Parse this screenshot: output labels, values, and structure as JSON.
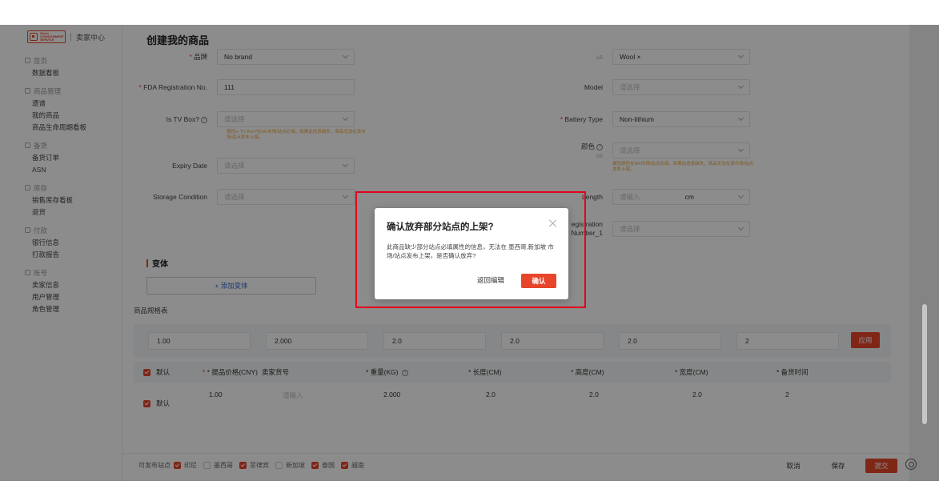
{
  "sidebar": {
    "logo_text": [
      "Shein",
      "CONSIGNMENT",
      "SERVICE"
    ],
    "brand_title": "卖家中心",
    "sections": [
      {
        "head": "首页",
        "items": [
          "数据看板"
        ]
      },
      {
        "head": "商品管理",
        "items": [
          "遗谱",
          "我的商品",
          "商品生命周期看板"
        ]
      },
      {
        "head": "备货",
        "items": [
          "备货订单",
          "ASN"
        ]
      },
      {
        "head": "库存",
        "items": [
          "销售库存看板",
          "退货"
        ]
      },
      {
        "head": "付款",
        "items": [
          "银行信息",
          "打款报告"
        ]
      },
      {
        "head": "账号",
        "items": [
          "卖家信息",
          "用户管理",
          "角色管理"
        ]
      }
    ]
  },
  "page": {
    "title": "创建我的商品",
    "brand_label": "品牌",
    "brand_value": "No brand",
    "fda_label": "FDA Registration No.",
    "fda_value": "111",
    "tvbox_label": "Is TV Box?",
    "tvbox_placeholder": "请选择",
    "tvbox_hint": "属性Is TV Box?在SG市场/站点必填。如果此信息缺失，商品无法在该市场/站点发布上架。",
    "expiry_label": "Expiry Date",
    "expiry_placeholder": "请选择",
    "storage_label": "Storage Condition",
    "storage_placeholder": "请选择",
    "material_count": "1/5",
    "material_value": "Wool ×",
    "model_label": "Model",
    "model_placeholder": "请选择",
    "battery_label": "Battery Type",
    "battery_value": "Non-lithium",
    "color_label": "颜色",
    "color_count": "0/5",
    "color_placeholder": "请选择",
    "color_hint": "属性颜色在MX市场/站点必填。如果此信息缺失，商品无法在该市场/站点发布上架。",
    "length_label": "Length",
    "length_placeholder": "请输入",
    "length_unit": "cm",
    "reg_label_1": "egistration",
    "reg_label_2": "Number_1",
    "reg_placeholder": "请选择",
    "variant_section": "变体",
    "add_variant": "+ 添加变体",
    "spec_table_label": "商品规格表",
    "batch_values": [
      "1.00",
      "2.000",
      "2.0",
      "2.0",
      "2.0",
      "2"
    ],
    "apply_label": "应用",
    "table_headers": [
      "默认",
      "* 提品价格(CNY)",
      "卖家货号",
      "* 重量(KG)",
      "* 长度(CM)",
      "* 高度(CM)",
      "* 宽度(CM)",
      "* 备货时间"
    ],
    "row": {
      "default": "默认",
      "price": "1.00",
      "sku_placeholder": "请输入",
      "weight": "2.000",
      "length": "2.0",
      "height": "2.0",
      "width": "2.0",
      "lead": "2"
    }
  },
  "footer": {
    "sites_label": "可发布站点",
    "sites": [
      {
        "name": "印尼",
        "checked": true
      },
      {
        "name": "墨西哥",
        "checked": false
      },
      {
        "name": "菲律宾",
        "checked": true
      },
      {
        "name": "新加坡",
        "checked": false
      },
      {
        "name": "泰国",
        "checked": true
      },
      {
        "name": "越南",
        "checked": true
      }
    ],
    "cancel": "取消",
    "save": "保存",
    "submit": "提交"
  },
  "dialog": {
    "title": "确认放弃部分站点的上架?",
    "body": "此商品缺少部分站点必填属性的信息，无法在 墨西哥,新加坡 市场/站点发布上架，是否确认放弃?",
    "back": "返回编辑",
    "confirm": "确认"
  },
  "colors": {
    "accent": "#e8462a",
    "highlight": "#e3001b",
    "hint": "#e8a33a",
    "link": "#3366cc"
  }
}
